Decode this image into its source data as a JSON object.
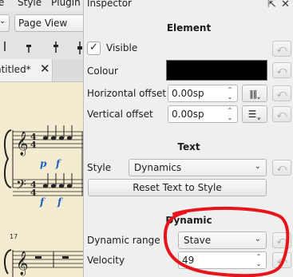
{
  "menubar": {
    "items": [
      "e",
      "Style",
      "Plugin"
    ]
  },
  "toolbar": {
    "view_mode": "Page View"
  },
  "tab": {
    "title": "ntitled*",
    "close": "✕"
  },
  "score": {
    "dynamics_upper": [
      "p",
      "f"
    ],
    "dynamics_lower": [
      "f",
      "f"
    ],
    "measure_number": "17"
  },
  "inspector": {
    "title": "Inspector",
    "element": {
      "header": "Element",
      "visible_label": "Visible",
      "visible_checked": true,
      "colour_label": "Colour",
      "colour_value": "#000000",
      "h_offset_label": "Horizontal offset",
      "h_offset_value": "0.00sp",
      "v_offset_label": "Vertical offset",
      "v_offset_value": "0.00sp"
    },
    "text": {
      "header": "Text",
      "style_label": "Style",
      "style_value": "Dynamics",
      "reset_button": "Reset Text to Style"
    },
    "dynamic": {
      "header": "Dynamic",
      "range_label": "Dynamic range",
      "range_value": "Stave",
      "velocity_label": "Velocity",
      "velocity_value": "49"
    }
  },
  "colors": {
    "annotation_red": "#e8141b",
    "dynamics_blue": "#1a5fc4",
    "score_paper": "#f4ecd0"
  }
}
